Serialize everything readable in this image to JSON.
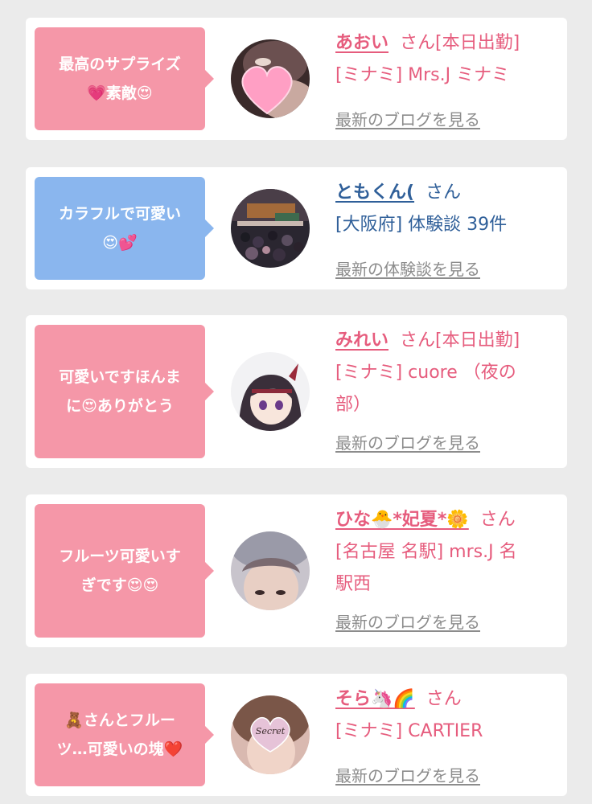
{
  "cards": [
    {
      "bubble_color": "#f597a8",
      "bubble_lines": [
        "最高のサプライズ",
        "💗素敵😍"
      ],
      "name": "あおい",
      "honorific": "さん[本日出勤]",
      "detail_lines": [
        "[ミナミ] Mrs.J ミナミ"
      ],
      "link": "最新のブログを見る",
      "avatar_icon": "heart-photo"
    },
    {
      "bubble_color": "#8ab6ee",
      "bubble_lines": [
        "カラフルで可愛い",
        "😍💕"
      ],
      "name": "ともくん(",
      "honorific": "さん",
      "detail_lines": [
        "[大阪府] 体験談 39件"
      ],
      "link": "最新の体験談を見る",
      "avatar_icon": "street-photo"
    },
    {
      "bubble_color": "#f597a8",
      "bubble_lines": [
        "可愛いですほんま",
        "に😍ありがとう"
      ],
      "name": "みれい",
      "honorific": "さん[本日出勤]",
      "detail_lines": [
        "[ミナミ] cuore （夜の",
        "部）"
      ],
      "link": "最新のブログを見る",
      "avatar_icon": "anime-girl"
    },
    {
      "bubble_color": "#f597a8",
      "bubble_lines": [
        "フルーツ可愛いす",
        "ぎです😍😍"
      ],
      "name": "ひな🐣*妃夏*🌼",
      "honorific": "さん",
      "detail_lines": [
        "[名古屋 名駅] mrs.J 名",
        "駅西"
      ],
      "link": "最新のブログを見る",
      "avatar_icon": "face-photo"
    },
    {
      "bubble_color": "#f597a8",
      "bubble_lines": [
        "🧸さんとフルー",
        "ツ…可愛いの塊❤️"
      ],
      "name": "そら🦄🌈",
      "honorific": "さん",
      "detail_lines": [
        "[ミナミ] CARTIER"
      ],
      "link": "最新のブログを見る",
      "avatar_icon": "secret-heart-photo",
      "avatar_text": "Secret"
    }
  ]
}
